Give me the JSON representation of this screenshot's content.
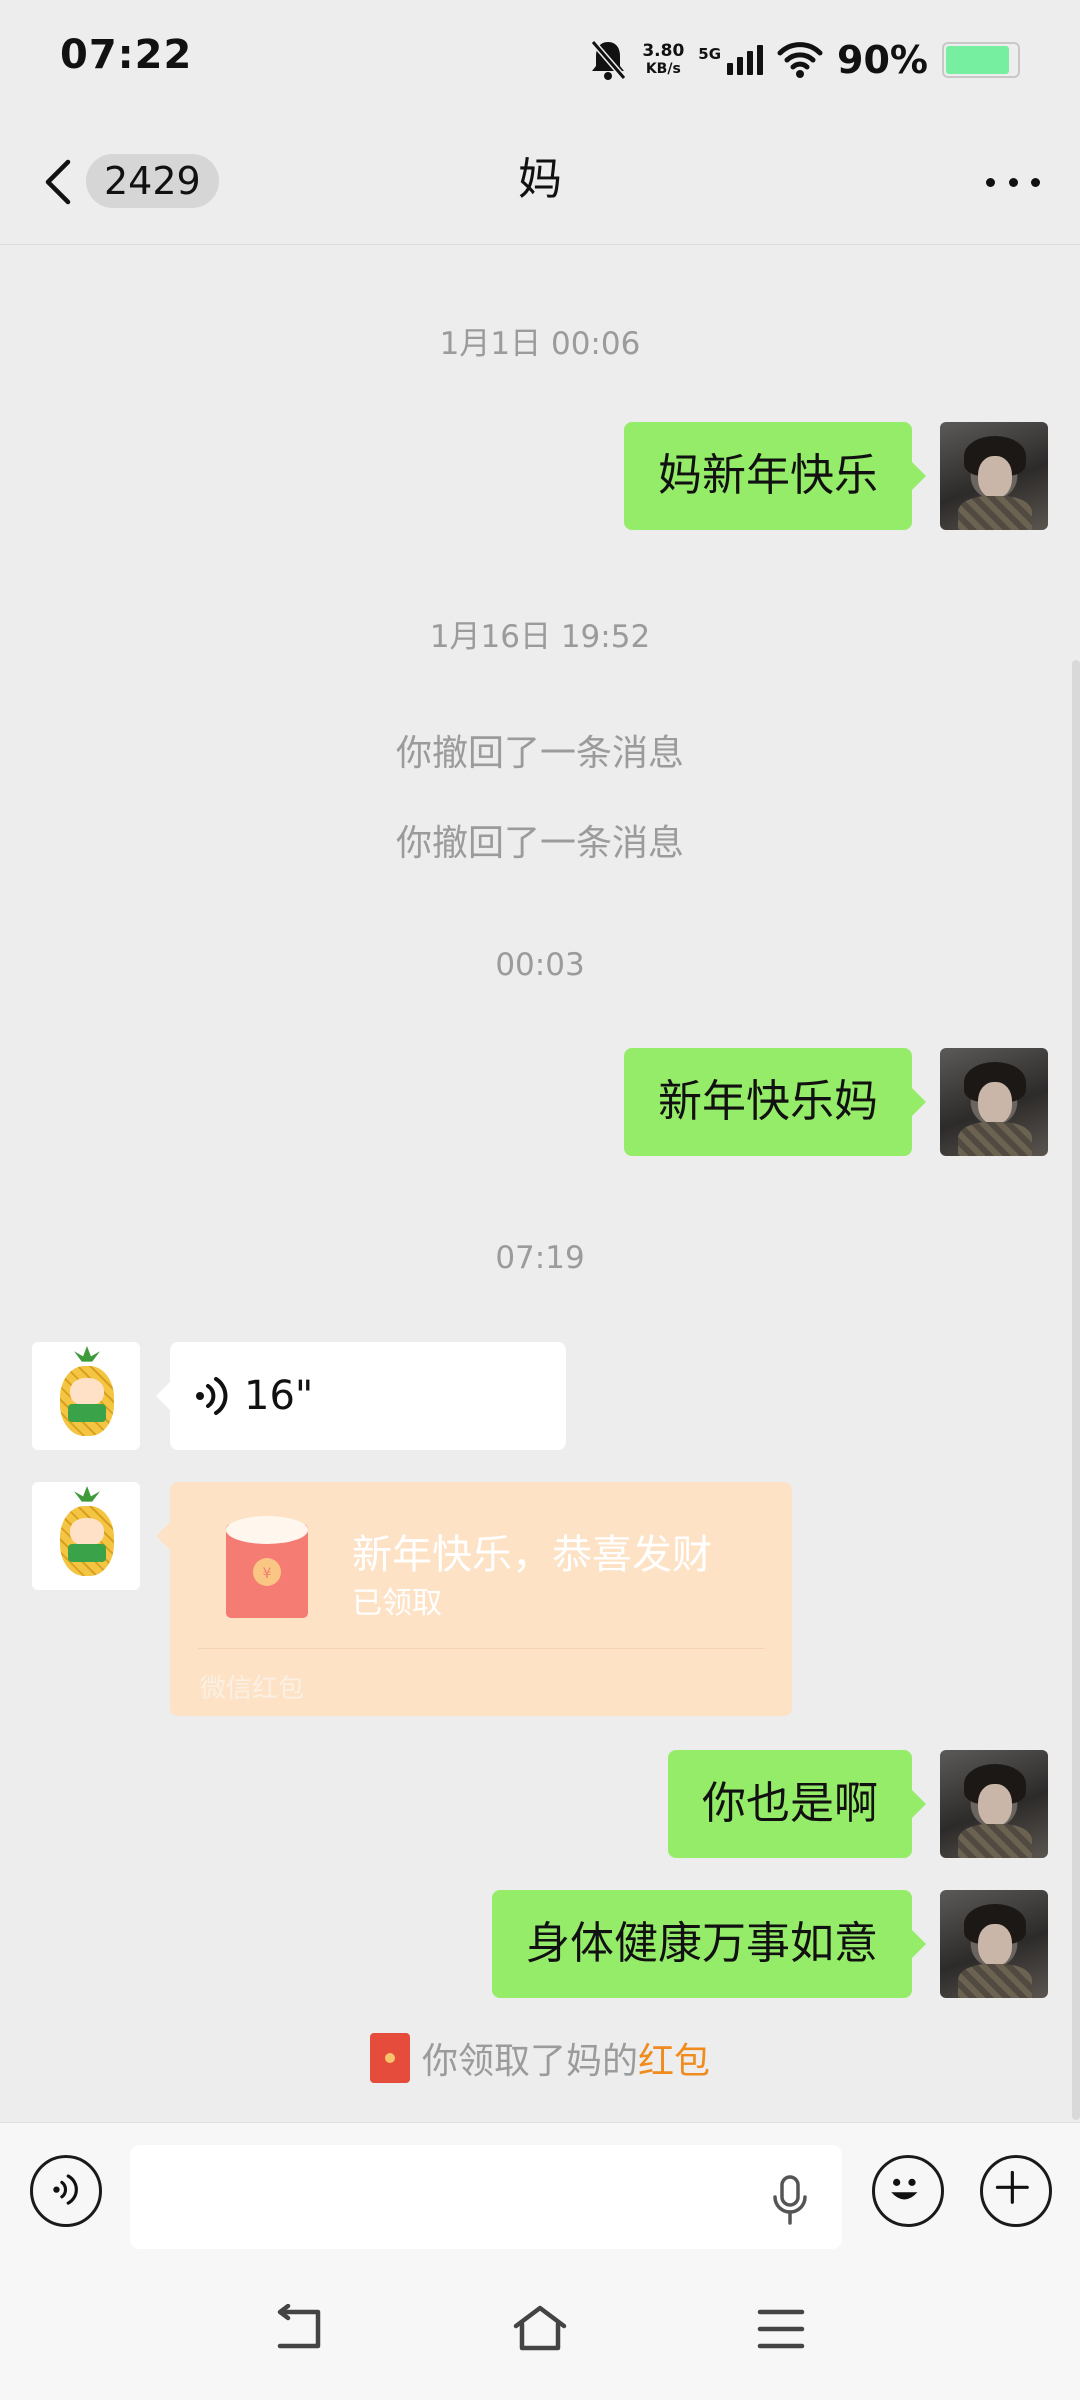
{
  "status_bar": {
    "time": "07:22",
    "net_speed_value": "3.80",
    "net_speed_unit": "KB/s",
    "network_type": "5G",
    "battery_percent": "90%",
    "battery_level": 0.9,
    "battery_color": "#76f0a0"
  },
  "nav": {
    "unread_count": "2429",
    "title": "妈",
    "icons": [
      "chevron-left-icon",
      "more-icon"
    ]
  },
  "chat": {
    "ts1": "1月1日 00:06",
    "msg1": "妈新年快乐",
    "ts2": "1月16日 19:52",
    "recall1": "你撤回了一条消息",
    "recall2": "你撤回了一条消息",
    "ts3": "00:03",
    "msg2": "新年快乐妈",
    "ts4": "07:19",
    "voice_duration": "16\"",
    "red_packet": {
      "title": "新年快乐，恭喜发财",
      "status": "已领取",
      "footer": "微信红包"
    },
    "msg3": "你也是啊",
    "msg4": "身体健康万事如意",
    "notice_prefix": "你领取了妈的",
    "notice_link": "红包"
  },
  "input": {
    "placeholder": "",
    "icons": [
      "voice-mode-icon",
      "mic-icon",
      "emoji-icon",
      "plus-icon"
    ]
  },
  "colors": {
    "outgoing_bubble": "#95ec69",
    "background": "#ededed",
    "red_packet_card": "#fde2c6",
    "link_orange": "#f08c1e"
  }
}
